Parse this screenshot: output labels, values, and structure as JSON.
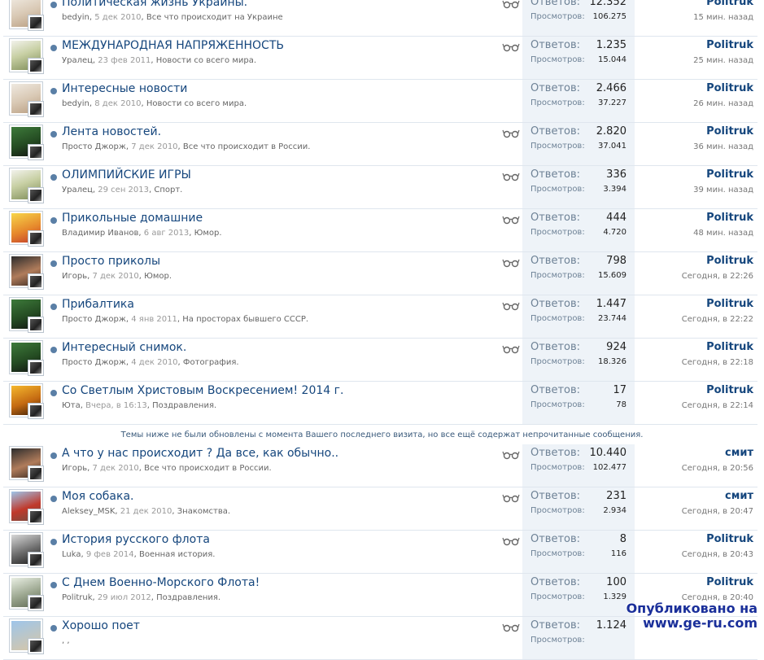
{
  "labels": {
    "replies": "Ответов:",
    "views": "Просмотров:"
  },
  "notice": "Темы ниже не были обновлены с момента Вашего последнего визита, но все ещё содержат непрочитанные сообщения.",
  "watermark": {
    "line1": "Опубликовано на",
    "line2": "www.ge-ru.com"
  },
  "topics": [
    {
      "title": "Политическая жизнь Украины.",
      "author": "bedyin",
      "date": "5 дек 2010",
      "forum": "Все что происходит на Украине",
      "replies": "12.352",
      "views": "106.275",
      "last_user": "Politruk",
      "last_time": "15 мин. назад",
      "watched": true
    },
    {
      "title": "МЕЖДУНАРОДНАЯ НАПРЯЖЕННОСТЬ",
      "author": "Уралец",
      "date": "23 фев 2011",
      "forum": "Новости со всего мира.",
      "replies": "1.235",
      "views": "15.044",
      "last_user": "Politruk",
      "last_time": "25 мин. назад",
      "watched": true
    },
    {
      "title": "Интересные новости",
      "author": "bedyin",
      "date": "8 дек 2010",
      "forum": "Новости со всего мира.",
      "replies": "2.466",
      "views": "37.227",
      "last_user": "Politruk",
      "last_time": "26 мин. назад",
      "watched": false
    },
    {
      "title": "Лента новостей.",
      "author": "Просто Джорж",
      "date": "7 дек 2010",
      "forum": "Все что происходит в России.",
      "replies": "2.820",
      "views": "37.041",
      "last_user": "Politruk",
      "last_time": "36 мин. назад",
      "watched": true
    },
    {
      "title": "ОЛИМПИЙСКИЕ ИГРЫ",
      "author": "Уралец",
      "date": "29 сен 2013",
      "forum": "Спорт.",
      "replies": "336",
      "views": "3.394",
      "last_user": "Politruk",
      "last_time": "39 мин. назад",
      "watched": true
    },
    {
      "title": "Прикольные домашние",
      "author": "Владимир Иванов",
      "date": "6 авг 2013",
      "forum": "Юмор.",
      "replies": "444",
      "views": "4.720",
      "last_user": "Politruk",
      "last_time": "48 мин. назад",
      "watched": true
    },
    {
      "title": "Просто приколы",
      "author": "Игорь",
      "date": "7 дек 2010",
      "forum": "Юмор.",
      "replies": "798",
      "views": "15.609",
      "last_user": "Politruk",
      "last_time": "Сегодня, в 22:26",
      "watched": true
    },
    {
      "title": "Прибалтика",
      "author": "Просто Джорж",
      "date": "4 янв 2011",
      "forum": "На просторах бывшего СССР.",
      "replies": "1.447",
      "views": "23.744",
      "last_user": "Politruk",
      "last_time": "Сегодня, в 22:22",
      "watched": true
    },
    {
      "title": "Интересный снимок.",
      "author": "Просто Джорж",
      "date": "4 дек 2010",
      "forum": "Фотография.",
      "replies": "924",
      "views": "18.326",
      "last_user": "Politruk",
      "last_time": "Сегодня, в 22:18",
      "watched": true
    },
    {
      "title": "Со Светлым Христовым Воскресением! 2014 г.",
      "author": "Юта",
      "date": "Вчера, в 16:13",
      "forum": "Поздравления.",
      "replies": "17",
      "views": "78",
      "last_user": "Politruk",
      "last_time": "Сегодня, в 22:14",
      "watched": false
    },
    {
      "title": "А что у нас происходит ? Да все, как обычно..",
      "author": "Игорь",
      "date": "7 дек 2010",
      "forum": "Все что происходит в России.",
      "replies": "10.440",
      "views": "102.477",
      "last_user": "смит",
      "last_time": "Сегодня, в 20:56",
      "watched": true
    },
    {
      "title": "Моя собака.",
      "author": "Aleksey_MSK",
      "date": "21 дек 2010",
      "forum": "Знакомства.",
      "replies": "231",
      "views": "2.934",
      "last_user": "смит",
      "last_time": "Сегодня, в 20:47",
      "watched": true
    },
    {
      "title": "История русского флота",
      "author": "Luka",
      "date": "9 фев 2014",
      "forum": "Военная история.",
      "replies": "8",
      "views": "116",
      "last_user": "Politruk",
      "last_time": "Сегодня, в 20:43",
      "watched": true
    },
    {
      "title": "С Днем Военно-Морского Флота!",
      "author": "Politruk",
      "date": "29 июл 2012",
      "forum": "Поздравления.",
      "replies": "100",
      "views": "1.329",
      "last_user": "Politruk",
      "last_time": "Сегодня, в 20:40",
      "watched": false
    },
    {
      "title": "Хорошо поет",
      "author": "",
      "date": "",
      "forum": "",
      "replies": "1.124",
      "views": "",
      "last_user": "",
      "last_time": "",
      "watched": true
    }
  ]
}
